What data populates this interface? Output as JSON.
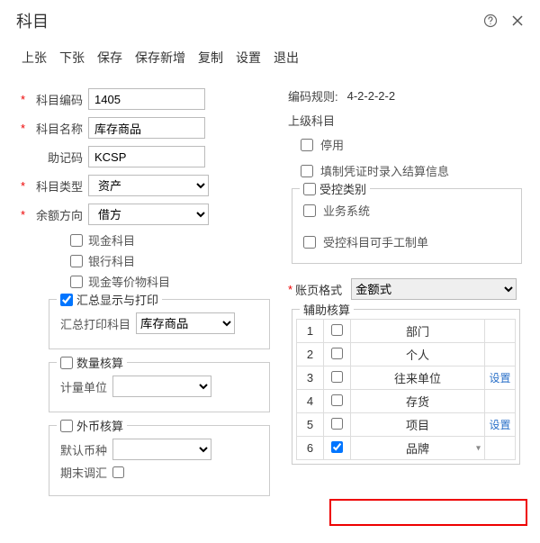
{
  "window": {
    "title": "科目"
  },
  "toolbar": {
    "prev": "上张",
    "next": "下张",
    "save": "保存",
    "saveNew": "保存新增",
    "copy": "复制",
    "settings": "设置",
    "exit": "退出"
  },
  "left": {
    "code_lbl": "科目编码",
    "code_val": "1405",
    "name_lbl": "科目名称",
    "name_val": "库存商品",
    "mnemonic_lbl": "助记码",
    "mnemonic_val": "KCSP",
    "type_lbl": "科目类型",
    "type_val": "资产",
    "direction_lbl": "余额方向",
    "direction_val": "借方",
    "chk_cash": "现金科目",
    "chk_bank": "银行科目",
    "chk_cashlike": "现金等价物科目",
    "grp_summary": "汇总显示与打印",
    "summary_print_lbl": "汇总打印科目",
    "summary_print_val": "库存商品",
    "grp_qty": "数量核算",
    "qty_unit_lbl": "计量单位",
    "grp_fx": "外币核算",
    "fx_curr_lbl": "默认币种",
    "fx_period_lbl": "期末调汇"
  },
  "right": {
    "rule_lbl": "编码规则:",
    "rule_val": "4-2-2-2-2",
    "parent_lbl": "上级科目",
    "chk_disabled": "停用",
    "chk_voucher": "填制凭证时录入结算信息",
    "grp_ctrl": "受控类别",
    "ctrl_biz": "业务系统",
    "ctrl_manual": "受控科目可手工制单",
    "pageformat_lbl": "账页格式",
    "pageformat_val": "金额式",
    "grp_aux": "辅助核算",
    "action_set": "设置",
    "aux_items": [
      {
        "idx": "1",
        "name": "部门",
        "checked": false,
        "act": ""
      },
      {
        "idx": "2",
        "name": "个人",
        "checked": false,
        "act": ""
      },
      {
        "idx": "3",
        "name": "往来单位",
        "checked": false,
        "act": "设置"
      },
      {
        "idx": "4",
        "name": "存货",
        "checked": false,
        "act": ""
      },
      {
        "idx": "5",
        "name": "项目",
        "checked": false,
        "act": "设置"
      },
      {
        "idx": "6",
        "name": "品牌",
        "checked": true,
        "act": ""
      }
    ]
  }
}
